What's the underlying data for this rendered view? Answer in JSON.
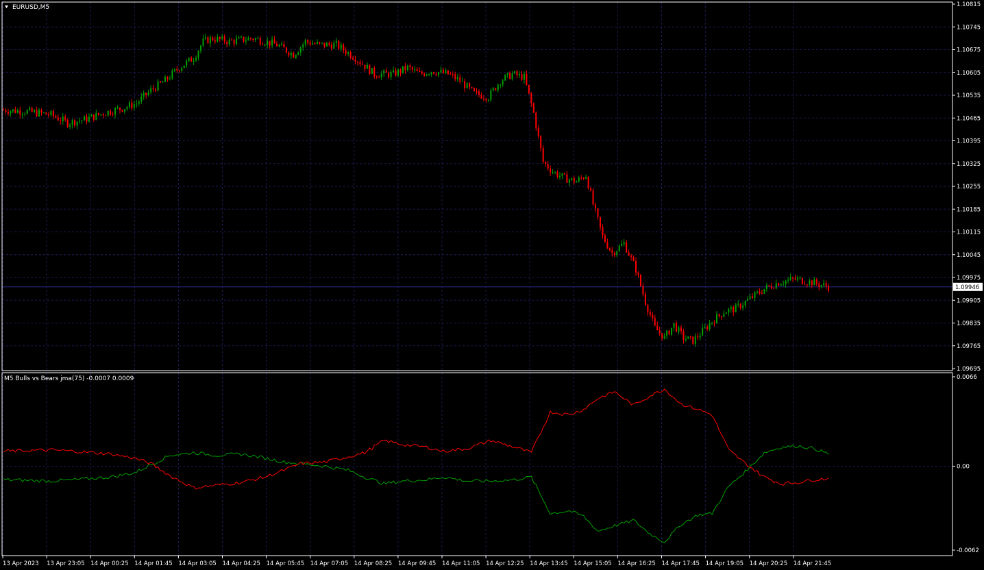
{
  "window": {
    "symbol_title": "EURUSD,M5",
    "indicator_title": "M5 Bulls vs Bears jma(75) -0.0007 0.0009"
  },
  "colors": {
    "background": "#000000",
    "frame": "#ffffff",
    "grid": "#1c1c55",
    "bull": "#00a000",
    "bear": "#ff0000",
    "price_line": "#2a2a90",
    "text": "#ffffff"
  },
  "chart_data": [
    {
      "type": "candlestick",
      "symbol": "EURUSD",
      "timeframe": "M5",
      "ylim": [
        1.09695,
        1.10815
      ],
      "y_ticks": [
        "1.10815",
        "1.10745",
        "1.10675",
        "1.10605",
        "1.10535",
        "1.10465",
        "1.10395",
        "1.10325",
        "1.10255",
        "1.10185",
        "1.10115",
        "1.10045",
        "1.09975",
        "1.09905",
        "1.09835",
        "1.09765",
        "1.09695"
      ],
      "current_price": "1.09946",
      "x_ticks": [
        "13 Apr 2023",
        "13 Apr 23:05",
        "14 Apr 00:25",
        "14 Apr 01:45",
        "14 Apr 03:05",
        "14 Apr 04:25",
        "14 Apr 05:45",
        "14 Apr 07:05",
        "14 Apr 08:25",
        "14 Apr 09:45",
        "14 Apr 11:05",
        "14 Apr 12:25",
        "14 Apr 13:45",
        "14 Apr 15:05",
        "14 Apr 16:25",
        "14 Apr 17:45",
        "14 Apr 19:05",
        "14 Apr 20:25",
        "14 Apr 21:45"
      ],
      "close_path": [
        [
          0,
          1.1049
        ],
        [
          10,
          1.10485
        ],
        [
          20,
          1.10475
        ],
        [
          27,
          1.1045
        ],
        [
          34,
          1.1046
        ],
        [
          42,
          1.1048
        ],
        [
          50,
          1.10495
        ],
        [
          56,
          1.1051
        ],
        [
          62,
          1.1055
        ],
        [
          68,
          1.1058
        ],
        [
          74,
          1.1062
        ],
        [
          80,
          1.1065
        ],
        [
          84,
          1.107
        ],
        [
          88,
          1.1071
        ],
        [
          95,
          1.107
        ],
        [
          105,
          1.1071
        ],
        [
          115,
          1.1069
        ],
        [
          122,
          1.1066
        ],
        [
          127,
          1.107
        ],
        [
          133,
          1.1069
        ],
        [
          140,
          1.1069
        ],
        [
          148,
          1.1065
        ],
        [
          156,
          1.106
        ],
        [
          164,
          1.106
        ],
        [
          170,
          1.1062
        ],
        [
          175,
          1.106
        ],
        [
          180,
          1.1061
        ],
        [
          187,
          1.106
        ],
        [
          192,
          1.1058
        ],
        [
          198,
          1.1054
        ],
        [
          204,
          1.1053
        ],
        [
          209,
          1.1058
        ],
        [
          214,
          1.106
        ],
        [
          219,
          1.1059
        ],
        [
          223,
          1.1048
        ],
        [
          227,
          1.1033
        ],
        [
          231,
          1.103
        ],
        [
          236,
          1.1028
        ],
        [
          241,
          1.1027
        ],
        [
          245,
          1.1029
        ],
        [
          248,
          1.102
        ],
        [
          252,
          1.101
        ],
        [
          256,
          1.1005
        ],
        [
          261,
          1.1008
        ],
        [
          266,
          1.1
        ],
        [
          270,
          1.099
        ],
        [
          274,
          1.0982
        ],
        [
          278,
          1.0979
        ],
        [
          282,
          1.0983
        ],
        [
          286,
          1.0979
        ],
        [
          290,
          1.0978
        ],
        [
          294,
          1.0981
        ],
        [
          298,
          1.0984
        ],
        [
          303,
          1.0987
        ],
        [
          308,
          1.0988
        ],
        [
          314,
          1.0991
        ],
        [
          320,
          1.0994
        ],
        [
          326,
          1.0996
        ],
        [
          333,
          1.0997
        ],
        [
          340,
          1.0996
        ],
        [
          347,
          1.09946
        ]
      ]
    },
    {
      "type": "line",
      "name": "M5 Bulls vs Bears jma(75)",
      "ylim": [
        -0.0062,
        0.0066
      ],
      "y_ticks": [
        "0.0066",
        "0.00",
        "-0.0062"
      ],
      "series": [
        {
          "color": "#00a000",
          "values": [
            [
              0,
              -0.001
            ],
            [
              20,
              -0.0011
            ],
            [
              30,
              -0.001
            ],
            [
              45,
              -0.0008
            ],
            [
              55,
              -0.0005
            ],
            [
              62,
              0.0001
            ],
            [
              70,
              0.0008
            ],
            [
              80,
              0.001
            ],
            [
              90,
              0.0008
            ],
            [
              100,
              0.0009
            ],
            [
              110,
              0.0006
            ],
            [
              118,
              0.0003
            ],
            [
              125,
              0.0002
            ],
            [
              135,
              0.0
            ],
            [
              145,
              -0.0003
            ],
            [
              152,
              -0.0008
            ],
            [
              160,
              -0.0013
            ],
            [
              168,
              -0.0011
            ],
            [
              178,
              -0.001
            ],
            [
              185,
              -0.0008
            ],
            [
              195,
              -0.0011
            ],
            [
              205,
              -0.0011
            ],
            [
              215,
              -0.001
            ],
            [
              222,
              -0.0008
            ],
            [
              230,
              -0.0035
            ],
            [
              238,
              -0.0033
            ],
            [
              244,
              -0.0037
            ],
            [
              250,
              -0.0048
            ],
            [
              257,
              -0.0044
            ],
            [
              265,
              -0.004
            ],
            [
              272,
              -0.005
            ],
            [
              278,
              -0.0056
            ],
            [
              285,
              -0.0043
            ],
            [
              292,
              -0.0036
            ],
            [
              298,
              -0.0035
            ],
            [
              305,
              -0.0015
            ],
            [
              312,
              -0.0004
            ],
            [
              320,
              0.001
            ],
            [
              327,
              0.0014
            ],
            [
              334,
              0.0015
            ],
            [
              341,
              0.0013
            ],
            [
              347,
              0.0009
            ]
          ]
        },
        {
          "color": "#ff0000",
          "values": [
            [
              0,
              0.0011
            ],
            [
              20,
              0.0012
            ],
            [
              30,
              0.0011
            ],
            [
              45,
              0.0009
            ],
            [
              55,
              0.0006
            ],
            [
              62,
              0.0002
            ],
            [
              70,
              -0.0007
            ],
            [
              80,
              -0.0016
            ],
            [
              90,
              -0.0014
            ],
            [
              100,
              -0.0012
            ],
            [
              110,
              -0.0008
            ],
            [
              118,
              -0.0003
            ],
            [
              125,
              0.0002
            ],
            [
              135,
              0.0003
            ],
            [
              145,
              0.0007
            ],
            [
              152,
              0.001
            ],
            [
              160,
              0.0019
            ],
            [
              168,
              0.0016
            ],
            [
              178,
              0.0014
            ],
            [
              185,
              0.0011
            ],
            [
              195,
              0.0013
            ],
            [
              205,
              0.0019
            ],
            [
              215,
              0.0014
            ],
            [
              222,
              0.001
            ],
            [
              230,
              0.004
            ],
            [
              238,
              0.0038
            ],
            [
              244,
              0.0042
            ],
            [
              250,
              0.005
            ],
            [
              257,
              0.0055
            ],
            [
              265,
              0.0045
            ],
            [
              272,
              0.0052
            ],
            [
              278,
              0.0057
            ],
            [
              285,
              0.0046
            ],
            [
              292,
              0.0042
            ],
            [
              298,
              0.0038
            ],
            [
              305,
              0.0012
            ],
            [
              312,
              0.0002
            ],
            [
              320,
              -0.0008
            ],
            [
              327,
              -0.0013
            ],
            [
              334,
              -0.0012
            ],
            [
              341,
              -0.001
            ],
            [
              347,
              -0.0009
            ]
          ]
        }
      ]
    }
  ]
}
